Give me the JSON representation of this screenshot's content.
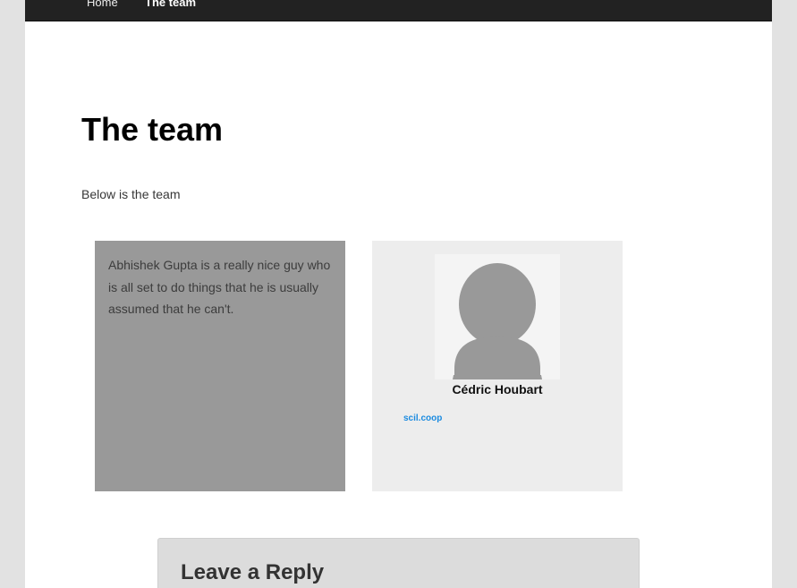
{
  "nav": {
    "items": [
      {
        "label": "Home"
      },
      {
        "label": "The team"
      }
    ]
  },
  "page": {
    "title": "The team",
    "intro": "Below is the team"
  },
  "team": {
    "bio_card": {
      "text": "Abhishek Gupta is a really nice guy who is all set to do things that he is usually assumed that he can't."
    },
    "profile_card": {
      "name": "Cédric Houbart",
      "link": "scil.coop"
    }
  },
  "reply": {
    "title": "Leave a Reply"
  },
  "colors": {
    "navbar": "#222222",
    "bio_card": "#999999",
    "profile_card": "#ededed",
    "link": "#1b8be0",
    "reply_box": "#dcdcdc"
  },
  "icons": {
    "avatar": "default-user-silhouette-icon"
  }
}
